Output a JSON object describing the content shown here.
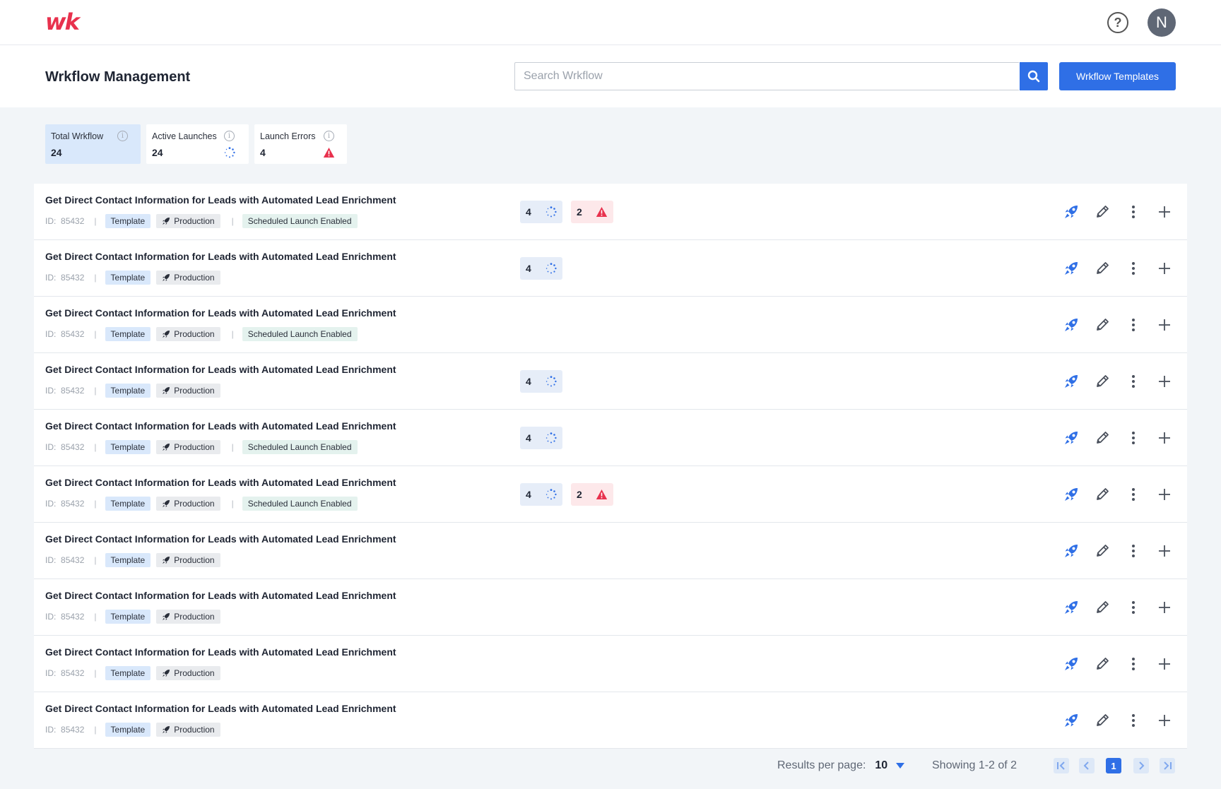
{
  "brand": {
    "logo_text": "wk",
    "accent": "#e8314d",
    "primary": "#2f6fe6"
  },
  "topbar": {
    "help_icon": "question-circle-icon",
    "avatar_initial": "N"
  },
  "header": {
    "title": "Wrkflow Management",
    "search_placeholder": "Search Wrkflow",
    "templates_button": "Wrkflow Templates"
  },
  "stats": [
    {
      "label": "Total Wrkflow",
      "value": "24",
      "selected": true
    },
    {
      "label": "Active Launches",
      "value": "24",
      "icon": "spinner-icon"
    },
    {
      "label": "Launch Errors",
      "value": "4",
      "icon": "warning-icon"
    }
  ],
  "workflows": [
    {
      "title": "Get Direct Contact Information for Leads with Automated Lead Enrichment",
      "id_label": "ID:",
      "id": "85432",
      "template": "Template",
      "env": "Production",
      "scheduled": "Scheduled Launch Enabled",
      "active": "4",
      "errors": "2"
    },
    {
      "title": "Get Direct Contact Information for Leads with Automated Lead Enrichment",
      "id_label": "ID:",
      "id": "85432",
      "template": "Template",
      "env": "Production",
      "scheduled": null,
      "active": "4",
      "errors": null
    },
    {
      "title": "Get Direct Contact Information for Leads with Automated Lead Enrichment",
      "id_label": "ID:",
      "id": "85432",
      "template": "Template",
      "env": "Production",
      "scheduled": "Scheduled Launch Enabled",
      "active": null,
      "errors": null
    },
    {
      "title": "Get Direct Contact Information for Leads with Automated Lead Enrichment",
      "id_label": "ID:",
      "id": "85432",
      "template": "Template",
      "env": "Production",
      "scheduled": null,
      "active": "4",
      "errors": null
    },
    {
      "title": "Get Direct Contact Information for Leads with Automated Lead Enrichment",
      "id_label": "ID:",
      "id": "85432",
      "template": "Template",
      "env": "Production",
      "scheduled": "Scheduled Launch Enabled",
      "active": "4",
      "errors": null
    },
    {
      "title": "Get Direct Contact Information for Leads with Automated Lead Enrichment",
      "id_label": "ID:",
      "id": "85432",
      "template": "Template",
      "env": "Production",
      "scheduled": "Scheduled Launch Enabled",
      "active": "4",
      "errors": "2"
    },
    {
      "title": "Get Direct Contact Information for Leads with Automated Lead Enrichment",
      "id_label": "ID:",
      "id": "85432",
      "template": "Template",
      "env": "Production",
      "scheduled": null,
      "active": null,
      "errors": null
    },
    {
      "title": "Get Direct Contact Information for Leads with Automated Lead Enrichment",
      "id_label": "ID:",
      "id": "85432",
      "template": "Template",
      "env": "Production",
      "scheduled": null,
      "active": null,
      "errors": null
    },
    {
      "title": "Get Direct Contact Information for Leads with Automated Lead Enrichment",
      "id_label": "ID:",
      "id": "85432",
      "template": "Template",
      "env": "Production",
      "scheduled": null,
      "active": null,
      "errors": null
    },
    {
      "title": "Get Direct Contact Information for Leads with Automated Lead Enrichment",
      "id_label": "ID:",
      "id": "85432",
      "template": "Template",
      "env": "Production",
      "scheduled": null,
      "active": null,
      "errors": null
    }
  ],
  "row_actions": [
    "rocket-icon",
    "pencil-icon",
    "kebab-menu-icon",
    "plus-icon"
  ],
  "pagination": {
    "per_page_label": "Results per page:",
    "per_page_value": "10",
    "showing": "Showing 1-2 of 2",
    "current_page": "1"
  }
}
